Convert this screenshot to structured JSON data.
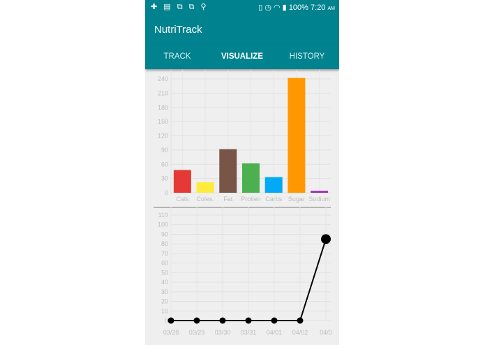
{
  "status_bar": {
    "left_icons": "✚ ▤ ⧉ ⧉ ⚲",
    "right_icons": "▯ ◷ ◠ ▮",
    "battery": "100%",
    "time": "7:20",
    "ampm": "AM"
  },
  "app": {
    "title": "NutriTrack"
  },
  "tabs": [
    {
      "label": "TRACK",
      "active": false
    },
    {
      "label": "VISUALIZE",
      "active": true
    },
    {
      "label": "HISTORY",
      "active": false
    }
  ],
  "chart_data": [
    {
      "type": "bar",
      "categories": [
        "Cals",
        "Coles.",
        "Fat",
        "Protien",
        "Carbs",
        "Sugar",
        "Sodium"
      ],
      "values": [
        48,
        22,
        92,
        62,
        33,
        242,
        4
      ],
      "colors": [
        "#e53935",
        "#ffeb3b",
        "#795548",
        "#4caf50",
        "#03a9f4",
        "#ff9800",
        "#9c27b0"
      ],
      "yticks": [
        0,
        30,
        60,
        90,
        120,
        150,
        180,
        210,
        240
      ],
      "ylim": [
        0,
        240
      ],
      "grid": true
    },
    {
      "type": "line",
      "x": [
        "03/28",
        "03/29",
        "03/30",
        "03/31",
        "04/01",
        "04/02",
        "04/0"
      ],
      "series": [
        {
          "values": [
            0,
            0,
            0,
            0,
            0,
            0,
            85
          ],
          "color": "#000000"
        }
      ],
      "yticks": [
        0,
        10,
        20,
        30,
        40,
        50,
        60,
        70,
        80,
        90,
        100,
        110
      ],
      "ylim": [
        0,
        110
      ],
      "grid": true
    }
  ]
}
